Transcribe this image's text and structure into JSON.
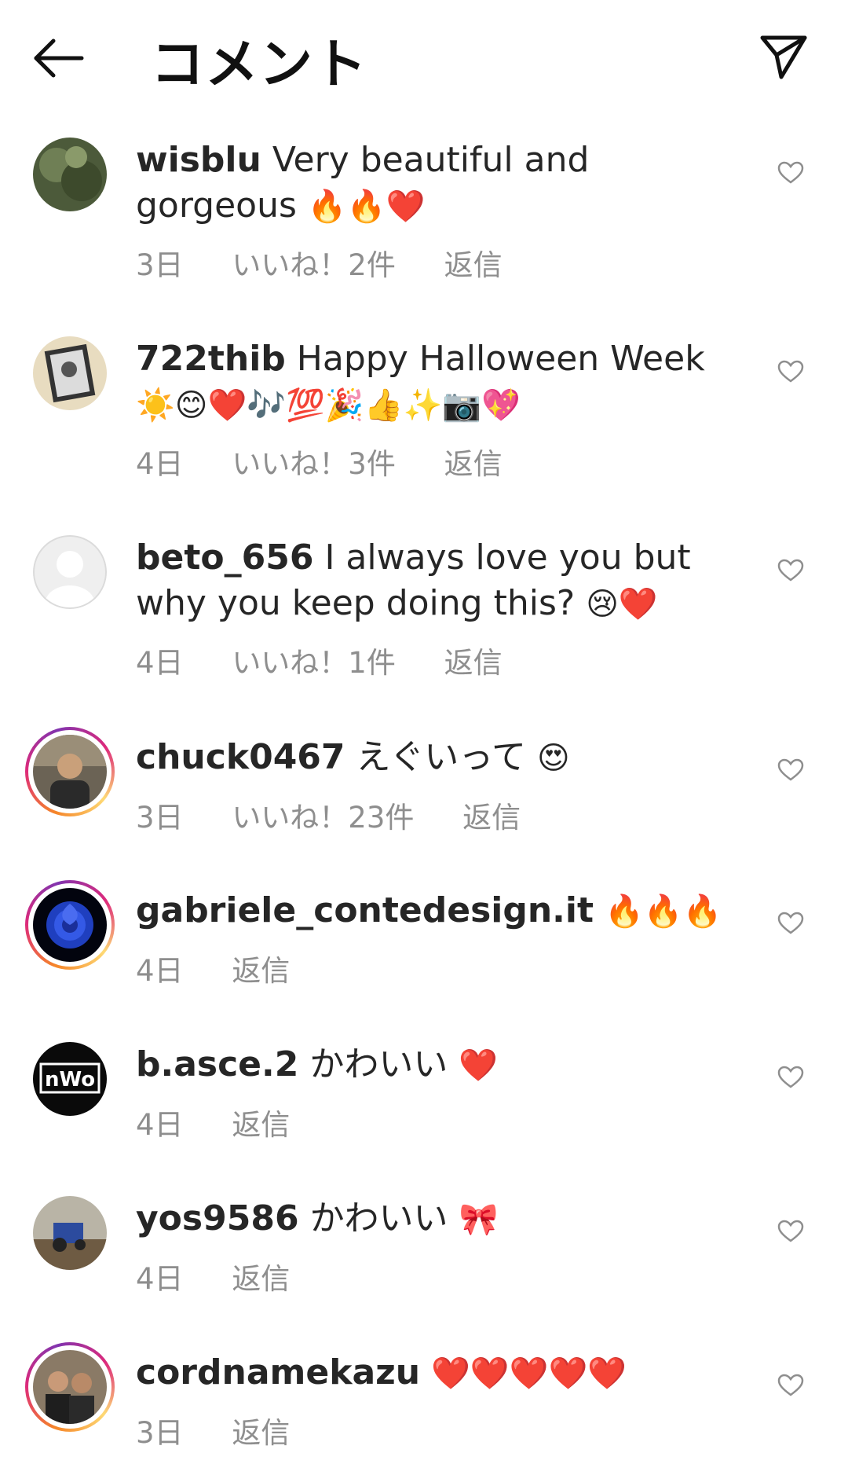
{
  "header": {
    "title": "コメント"
  },
  "comments": [
    {
      "username": "wisblu",
      "text": "Very beautiful and gorgeous",
      "emojis": "🔥🔥❤️",
      "time": "3日",
      "likes": "いいね！2件",
      "reply": "返信"
    },
    {
      "username": "722thib",
      "text": "Happy Halloween Week",
      "emojis": "☀️😊❤️🎶💯🎉👍✨📷💖",
      "time": "4日",
      "likes": "いいね！3件",
      "reply": "返信"
    },
    {
      "username": "beto_656",
      "text": "I always love you but why you keep doing this?",
      "emojis": "😢❤️",
      "time": "4日",
      "likes": "いいね！1件",
      "reply": "返信"
    },
    {
      "username": "chuck0467",
      "text": "えぐいって",
      "emojis": "😍",
      "time": "3日",
      "likes": "いいね！23件",
      "reply": "返信"
    },
    {
      "username": "gabriele_contedesign.it",
      "text": "",
      "emojis": "🔥🔥🔥",
      "time": "4日",
      "likes": "",
      "reply": "返信"
    },
    {
      "username": "b.asce.2",
      "text": "かわいい",
      "emojis": "❤️",
      "time": "4日",
      "likes": "",
      "reply": "返信"
    },
    {
      "username": "yos9586",
      "text": "かわいい",
      "emojis": "🎀",
      "time": "4日",
      "likes": "",
      "reply": "返信"
    },
    {
      "username": "cordnamekazu",
      "text": "",
      "emojis": "❤️❤️❤️❤️❤️",
      "time": "3日",
      "likes": "",
      "reply": "返信"
    }
  ],
  "avatar_badge_text": "nWo",
  "colors": {
    "text": "#262626",
    "meta": "#8e8e8e",
    "heart": "#e0201b",
    "fire": "#e0201b"
  }
}
